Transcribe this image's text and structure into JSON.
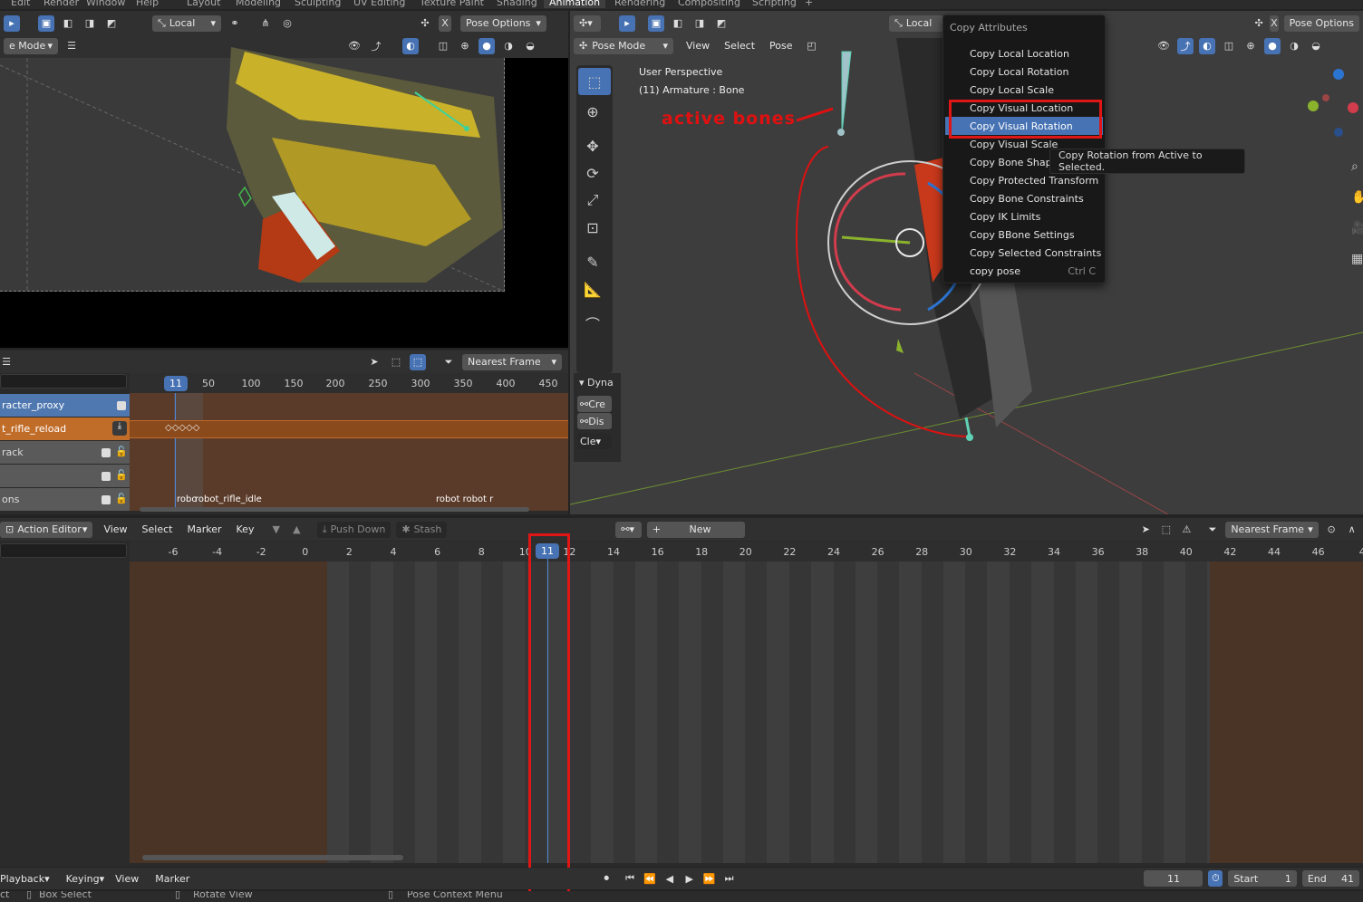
{
  "topbar": {
    "menus": [
      "Edit",
      "Render",
      "Window",
      "Help"
    ],
    "workspaces": [
      "Layout",
      "Modeling",
      "Sculpting",
      "UV Editing",
      "Texture Paint",
      "Shading",
      "Animation",
      "Rendering",
      "Compositing",
      "Scripting"
    ],
    "active_workspace": "Animation"
  },
  "left_view": {
    "transform_orientation": "Local",
    "pose_options": "Pose Options",
    "mode": "e Mode"
  },
  "nla": {
    "snap": "Nearest Frame",
    "current_frame": "11",
    "ticks": [
      "50",
      "100",
      "150",
      "200",
      "250",
      "300",
      "350",
      "400",
      "450"
    ],
    "tracks": [
      "racter_proxy",
      "t_rifle_reload",
      "rack",
      "",
      "ons"
    ],
    "strips": [
      "robo",
      "robot_rifle_idle",
      "robot robot r"
    ]
  },
  "right_view": {
    "transform_orientation": "Local",
    "pose_options": "Pose Options",
    "mode": "Pose Mode",
    "menus": [
      "View",
      "Select",
      "Pose"
    ],
    "overlay_title": "User Perspective",
    "overlay_sub": "(11) Armature : Bone",
    "annotation": "active bones",
    "panel_title": "Dyna",
    "panel_buttons": [
      "Cre",
      "Dis",
      "Cle"
    ]
  },
  "menu": {
    "title": "Copy Attributes",
    "items": [
      {
        "label": "Copy Local Location",
        "shortcut": ""
      },
      {
        "label": "Copy Local Rotation",
        "shortcut": ""
      },
      {
        "label": "Copy Local Scale",
        "shortcut": ""
      },
      {
        "label": "Copy Visual Location",
        "shortcut": ""
      },
      {
        "label": "Copy Visual Rotation",
        "shortcut": ""
      },
      {
        "label": "Copy Visual Scale",
        "shortcut": ""
      },
      {
        "label": "Copy Bone Shape",
        "shortcut": ""
      },
      {
        "label": "Copy Protected Transform",
        "shortcut": ""
      },
      {
        "label": "Copy Bone Constraints",
        "shortcut": ""
      },
      {
        "label": "Copy IK Limits",
        "shortcut": ""
      },
      {
        "label": "Copy BBone Settings",
        "shortcut": ""
      },
      {
        "label": "Copy Selected Constraints",
        "shortcut": ""
      },
      {
        "label": "copy pose",
        "shortcut": "Ctrl C"
      }
    ],
    "highlighted": "Copy Visual Rotation",
    "tooltip": "Copy Rotation from Active to Selected."
  },
  "action_editor": {
    "mode": "Action Editor",
    "menus": [
      "View",
      "Select",
      "Marker",
      "Key"
    ],
    "push_down": "Push Down",
    "stash": "Stash",
    "new": "New",
    "snap": "Nearest Frame",
    "ticks": [
      "-6",
      "-4",
      "-2",
      "0",
      "2",
      "4",
      "6",
      "8",
      "10",
      "12",
      "14",
      "16",
      "18",
      "20",
      "22",
      "24",
      "26",
      "28",
      "30",
      "32",
      "34",
      "36",
      "38",
      "40",
      "42",
      "44",
      "46",
      "4"
    ],
    "current_frame": "11"
  },
  "timeline": {
    "menus": [
      "Playback",
      "Keying",
      "View",
      "Marker"
    ],
    "frame": "11",
    "start_label": "Start",
    "start": "1",
    "end_label": "End",
    "end": "41"
  },
  "status": {
    "items": [
      "Box Select",
      "Rotate View",
      "Pose Context Menu"
    ],
    "left_cut": "ct"
  }
}
